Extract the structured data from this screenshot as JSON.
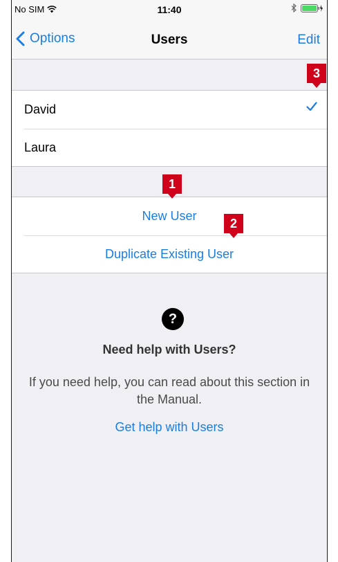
{
  "status": {
    "carrier": "No SIM",
    "time": "11:40"
  },
  "nav": {
    "back_label": "Options",
    "title": "Users",
    "edit_label": "Edit"
  },
  "users": [
    {
      "name": "David",
      "selected": true
    },
    {
      "name": "Laura",
      "selected": false
    }
  ],
  "actions": {
    "new_user": "New User",
    "duplicate_user": "Duplicate Existing User"
  },
  "help": {
    "icon": "?",
    "title": "Need help with Users?",
    "body": "If you need help, you can read about this section in the Manual.",
    "link": "Get help with Users"
  },
  "callouts": [
    "1",
    "2",
    "3"
  ],
  "colors": {
    "accent": "#1a7ee0",
    "callout": "#d0021b",
    "background": "#efeff4"
  }
}
